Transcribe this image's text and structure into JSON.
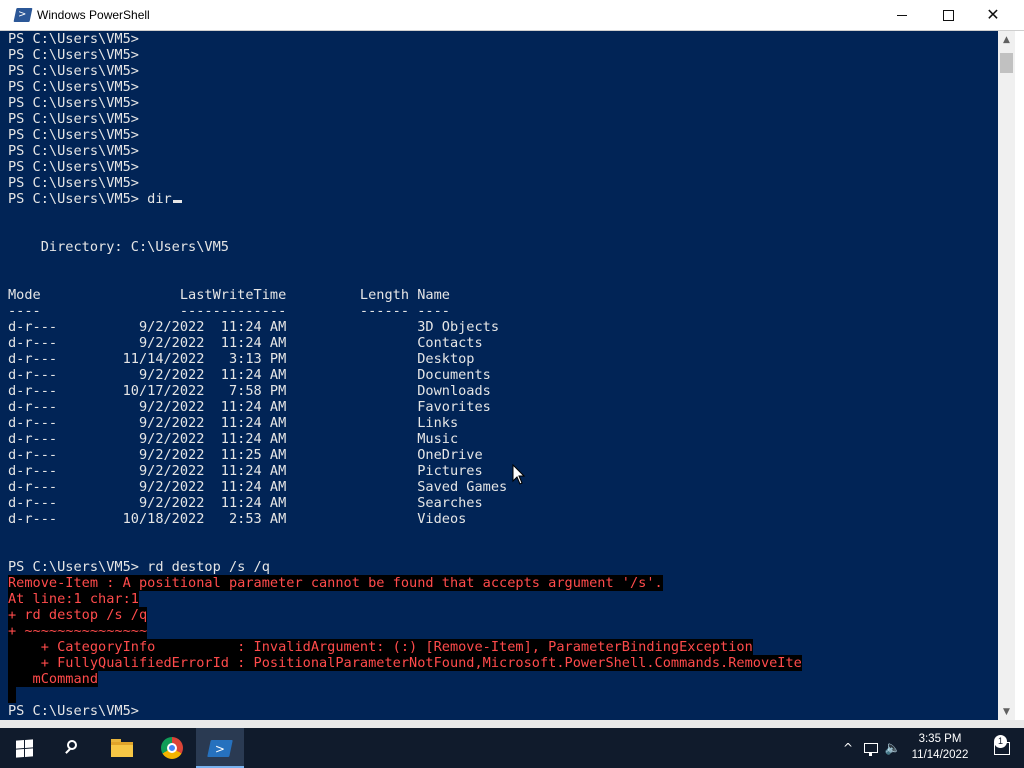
{
  "window": {
    "title": "Windows PowerShell",
    "app_icon": "powershell-icon",
    "controls": {
      "minimize": "minimize-icon",
      "maximize": "maximize-icon",
      "close": "✕"
    }
  },
  "console": {
    "lines": [
      {
        "text": "PS C:\\Users\\VM5>",
        "error": false
      },
      {
        "text": "PS C:\\Users\\VM5>",
        "error": false
      },
      {
        "text": "PS C:\\Users\\VM5>",
        "error": false
      },
      {
        "text": "PS C:\\Users\\VM5>",
        "error": false
      },
      {
        "text": "PS C:\\Users\\VM5>",
        "error": false
      },
      {
        "text": "PS C:\\Users\\VM5>",
        "error": false
      },
      {
        "text": "PS C:\\Users\\VM5>",
        "error": false
      },
      {
        "text": "PS C:\\Users\\VM5>",
        "error": false
      },
      {
        "text": "PS C:\\Users\\VM5>",
        "error": false
      },
      {
        "text": "PS C:\\Users\\VM5>",
        "error": false
      },
      {
        "text": "PS C:\\Users\\VM5> dir",
        "error": false,
        "cursor": true
      },
      {
        "text": "",
        "error": false
      },
      {
        "text": "",
        "error": false
      },
      {
        "text": "    Directory: C:\\Users\\VM5",
        "error": false
      },
      {
        "text": "",
        "error": false
      },
      {
        "text": "",
        "error": false
      },
      {
        "text": "Mode                 LastWriteTime         Length Name",
        "error": false
      },
      {
        "text": "----                 -------------         ------ ----",
        "error": false
      },
      {
        "text": "d-r---          9/2/2022  11:24 AM                3D Objects",
        "error": false
      },
      {
        "text": "d-r---          9/2/2022  11:24 AM                Contacts",
        "error": false
      },
      {
        "text": "d-r---        11/14/2022   3:13 PM                Desktop",
        "error": false
      },
      {
        "text": "d-r---          9/2/2022  11:24 AM                Documents",
        "error": false
      },
      {
        "text": "d-r---        10/17/2022   7:58 PM                Downloads",
        "error": false
      },
      {
        "text": "d-r---          9/2/2022  11:24 AM                Favorites",
        "error": false
      },
      {
        "text": "d-r---          9/2/2022  11:24 AM                Links",
        "error": false
      },
      {
        "text": "d-r---          9/2/2022  11:24 AM                Music",
        "error": false
      },
      {
        "text": "d-r---          9/2/2022  11:25 AM                OneDrive",
        "error": false
      },
      {
        "text": "d-r---          9/2/2022  11:24 AM                Pictures",
        "error": false
      },
      {
        "text": "d-r---          9/2/2022  11:24 AM                Saved Games",
        "error": false
      },
      {
        "text": "d-r---          9/2/2022  11:24 AM                Searches",
        "error": false
      },
      {
        "text": "d-r---        10/18/2022   2:53 AM                Videos",
        "error": false
      },
      {
        "text": "",
        "error": false
      },
      {
        "text": "",
        "error": false
      },
      {
        "text": "PS C:\\Users\\VM5> rd destop /s /q",
        "error": false
      },
      {
        "text": "Remove-Item : A positional parameter cannot be found that accepts argument '/s'.",
        "error": true
      },
      {
        "text": "At line:1 char:1",
        "error": true
      },
      {
        "text": "+ rd destop /s /q",
        "error": true
      },
      {
        "text": "+ ~~~~~~~~~~~~~~~",
        "error": true
      },
      {
        "text": "    + CategoryInfo          : InvalidArgument: (:) [Remove-Item], ParameterBindingException",
        "error": true
      },
      {
        "text": "    + FullyQualifiedErrorId : PositionalParameterNotFound,Microsoft.PowerShell.Commands.RemoveIte",
        "error": true
      },
      {
        "text": "   mCommand",
        "error": true
      },
      {
        "text": " ",
        "error": true
      },
      {
        "text": "PS C:\\Users\\VM5>",
        "error": false
      }
    ]
  },
  "colors": {
    "console_bg": "#012456",
    "console_fg": "#e6e6e6",
    "error_fg": "#ff4b4b",
    "error_bg": "#000000",
    "taskbar_bg": "#101b2c"
  },
  "taskbar": {
    "items": [
      "start-icon",
      "search-icon",
      "file-explorer-icon",
      "chrome-icon",
      "powershell-icon"
    ],
    "active_item": "powershell-icon",
    "tray": {
      "chevron": "^",
      "icons": [
        "network-icon",
        "volume-icon"
      ],
      "volume_glyph": "🔈"
    },
    "clock": {
      "time": "3:35 PM",
      "date": "11/14/2022"
    },
    "notifications": {
      "icon": "notification-icon",
      "count": "1"
    }
  }
}
